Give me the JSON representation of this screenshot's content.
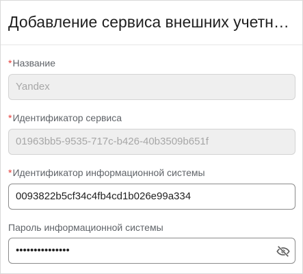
{
  "dialog": {
    "title": "Добавление сервиса внешних учетных записей"
  },
  "fields": {
    "name": {
      "required_mark": "*",
      "label": "Название",
      "value": "Yandex",
      "disabled": true
    },
    "service_id": {
      "required_mark": "*",
      "label": "Идентификатор сервиса",
      "value": "01963bb5-9535-717c-b426-40b3509b651f",
      "disabled": true
    },
    "info_system_id": {
      "required_mark": "*",
      "label": "Идентификатор информационной системы",
      "value": "0093822b5cf34c4fb4cd1b026e99a334",
      "disabled": false
    },
    "info_system_password": {
      "label": "Пароль информационной системы",
      "value_masked": "•••••••••••••••",
      "toggle_icon": "eye-off-icon"
    }
  },
  "colors": {
    "required": "#e53935",
    "disabled_bg": "#efefef",
    "disabled_text": "#a7a7a7",
    "label": "#5f6368",
    "text": "#1f1f1f"
  }
}
